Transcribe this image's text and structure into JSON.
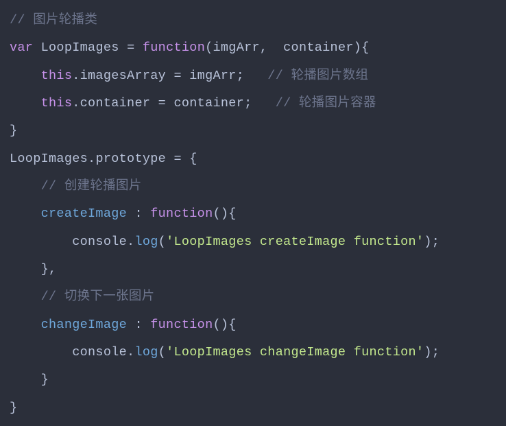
{
  "code": {
    "c1": "// 图片轮播类",
    "kw_var": "var",
    "id_Loop": "LoopImages",
    "kw_function": "function",
    "param_imgArr": "imgArr",
    "param_container": "container",
    "kw_this": "this",
    "prop_imagesArray": "imagesArray",
    "c2": "// 轮播图片数组",
    "prop_container": "container",
    "c3": "// 轮播图片容器",
    "prop_prototype": "prototype",
    "c4": "// 创建轮播图片",
    "method_createImage": "createImage",
    "call_console": "console",
    "call_log": "log",
    "str1": "'LoopImages createImage function'",
    "c5": "// 切换下一张图片",
    "method_changeImage": "changeImage",
    "str2": "'LoopImages changeImage function'"
  }
}
